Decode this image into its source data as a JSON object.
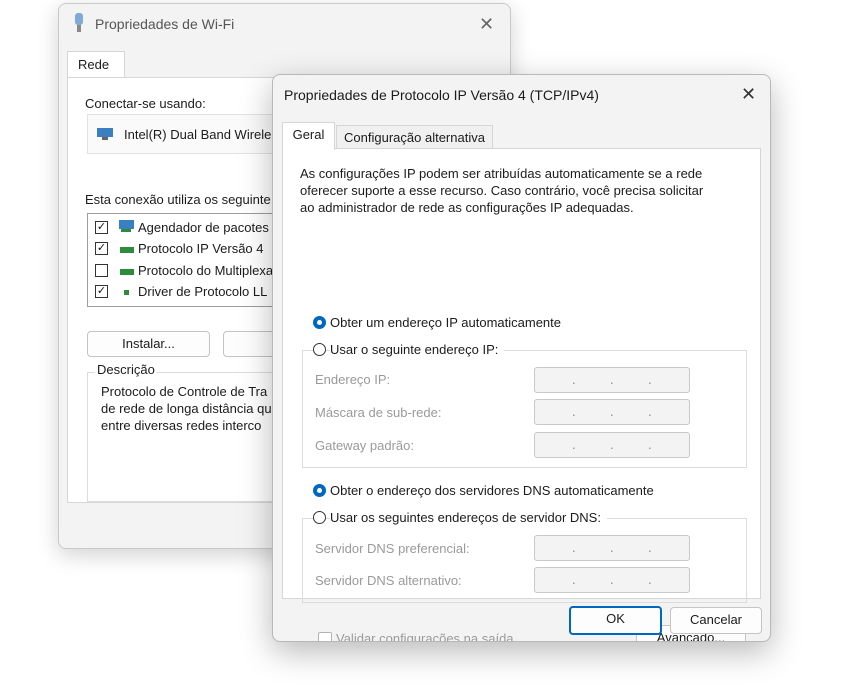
{
  "back_window": {
    "title": "Propriedades de Wi-Fi",
    "tab": "Rede",
    "connect_using_label": "Conectar-se usando:",
    "adapter_name": "Intel(R) Dual Band Wirele",
    "connection_uses_label": "Esta conexão utiliza os seguinte",
    "items": [
      {
        "label": "Agendador de pacotes",
        "checked": true
      },
      {
        "label": "Protocolo IP Versão 4",
        "checked": true
      },
      {
        "label": "Protocolo do Multiplexa",
        "checked": false
      },
      {
        "label": "Driver de Protocolo LL",
        "checked": true
      }
    ],
    "install_button": "Instalar...",
    "uninstall_button": "Des",
    "description_label": "Descrição",
    "description_lines": [
      "Protocolo de Controle de Tra",
      "de rede de longa distância qu",
      "entre diversas redes interco"
    ]
  },
  "dialog": {
    "title": "Propriedades de Protocolo IP Versão 4 (TCP/IPv4)",
    "tabs": [
      "Geral",
      "Configuração alternativa"
    ],
    "intro_lines": [
      "As configurações IP podem ser atribuídas automaticamente se a rede",
      "oferecer suporte a esse recurso. Caso contrário, você precisa solicitar",
      "ao administrador de rede as configurações IP adequadas."
    ],
    "ip_auto_label": "Obter um endereço IP automaticamente",
    "ip_manual_label": "Usar o seguinte endereço IP:",
    "ip_fields": [
      "Endereço IP:",
      "Máscara de sub-rede:",
      "Gateway padrão:"
    ],
    "dns_auto_label": "Obter o endereço dos servidores DNS automaticamente",
    "dns_manual_label": "Usar os seguintes endereços de servidor DNS:",
    "dns_fields": [
      "Servidor DNS preferencial:",
      "Servidor DNS alternativo:"
    ],
    "validate_label": "Validar configurações na saída",
    "advanced_button": "Avançado...",
    "ok_button": "OK",
    "cancel_button": "Cancelar",
    "ip_dot": "."
  },
  "colors": {
    "accent": "#0067c0"
  }
}
